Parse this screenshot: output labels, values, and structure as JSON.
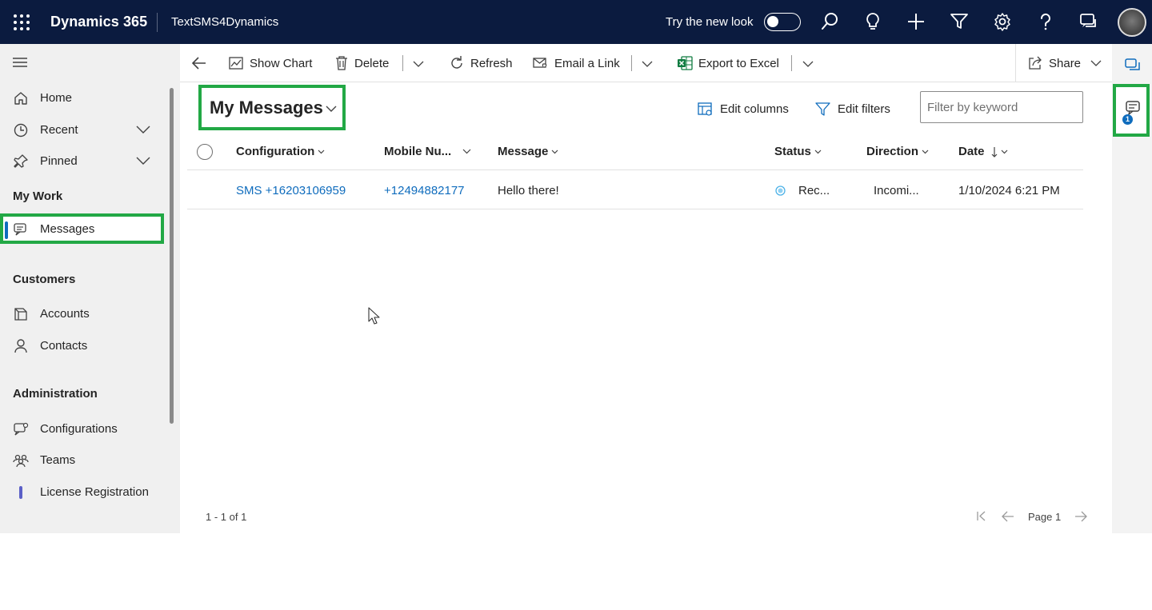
{
  "header": {
    "app_title": "Dynamics 365",
    "app_name": "TextSMS4Dynamics",
    "try_new_look": "Try the new look",
    "icons": [
      "search-icon",
      "lightbulb-icon",
      "plus-icon",
      "filter-icon",
      "gear-icon",
      "help-icon",
      "chat-icon"
    ]
  },
  "sidebar": {
    "items": [
      {
        "label": "Home",
        "icon": "home-icon"
      },
      {
        "label": "Recent",
        "icon": "clock-icon"
      },
      {
        "label": "Pinned",
        "icon": "pin-icon"
      }
    ],
    "section_my_work": "My Work",
    "messages": "Messages",
    "section_customers": "Customers",
    "accounts": "Accounts",
    "contacts": "Contacts",
    "section_admin": "Administration",
    "configurations": "Configurations",
    "teams": "Teams",
    "license": "License Registration"
  },
  "commands": {
    "show_chart": "Show Chart",
    "delete": "Delete",
    "refresh": "Refresh",
    "email_link": "Email a Link",
    "export_excel": "Export to Excel",
    "share": "Share"
  },
  "view": {
    "title": "My Messages",
    "edit_columns": "Edit columns",
    "edit_filters": "Edit filters",
    "filter_placeholder": "Filter by keyword"
  },
  "grid": {
    "columns": [
      "Configuration",
      "Mobile Nu...",
      "Message",
      "Status",
      "Direction",
      "Date"
    ],
    "rows": [
      {
        "configuration": "SMS +16203106959",
        "mobile": "+12494882177",
        "message": "Hello there!",
        "status": "Rec...",
        "direction": "Incomi...",
        "date": "1/10/2024 6:21 PM"
      }
    ]
  },
  "footer": {
    "count": "1 - 1 of 1",
    "page": "Page 1"
  },
  "notifications": {
    "badge_count": "1"
  },
  "colors": {
    "header_bg": "#0b1b3f",
    "highlight": "#22a845",
    "link": "#0f6cbd"
  }
}
